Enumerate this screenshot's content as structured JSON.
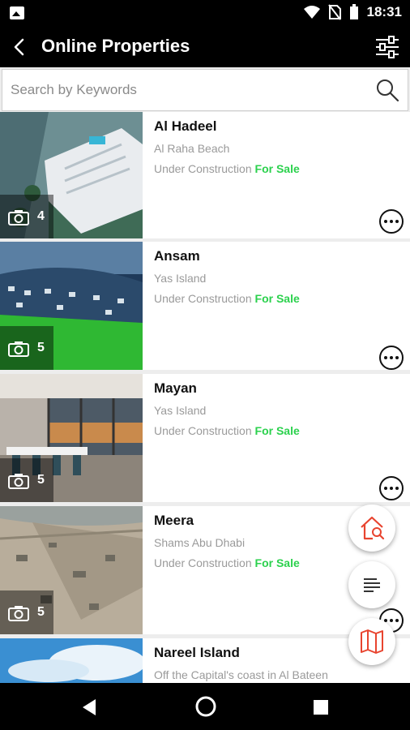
{
  "status_bar": {
    "time": "18:31"
  },
  "header": {
    "title": "Online Properties"
  },
  "search": {
    "placeholder": "Search by Keywords"
  },
  "colors": {
    "accent_red": "#e8442f",
    "sale_green": "#2bd14d"
  },
  "properties": [
    {
      "name": "Al Hadeel",
      "location": "Al Raha Beach",
      "status": "Under Construction",
      "sale": "For Sale",
      "photos": "4"
    },
    {
      "name": "Ansam",
      "location": "Yas Island",
      "status": "Under Construction",
      "sale": "For Sale",
      "photos": "5"
    },
    {
      "name": "Mayan",
      "location": "Yas Island",
      "status": "Under Construction",
      "sale": "For Sale",
      "photos": "5"
    },
    {
      "name": "Meera",
      "location": "Shams Abu Dhabi",
      "status": "Under Construction",
      "sale": "For Sale",
      "photos": "5"
    },
    {
      "name": "Nareel Island",
      "location": "Off the Capital's coast in Al Bateen"
    }
  ],
  "fabs": [
    "search-property-icon",
    "list-icon",
    "map-icon"
  ]
}
